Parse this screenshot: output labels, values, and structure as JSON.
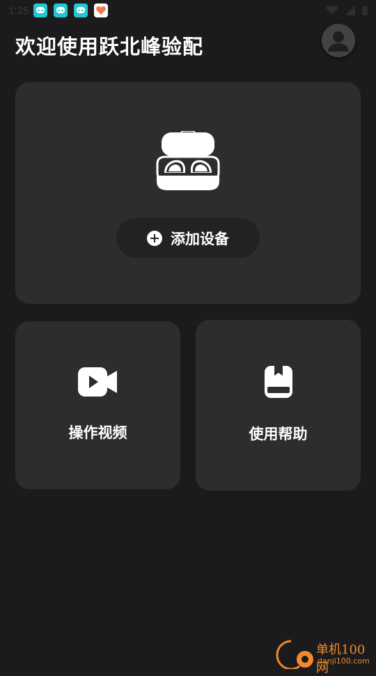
{
  "status_bar": {
    "time": "1:25",
    "notification_icons": [
      "app-icon-teal",
      "app-icon-teal",
      "app-icon-teal",
      "app-icon-orange"
    ],
    "right_icons": [
      "wifi-icon",
      "signal-icon",
      "battery-icon"
    ]
  },
  "header": {
    "title": "欢迎使用跃北峰验配",
    "avatar_icon": "user-avatar-icon"
  },
  "main_card": {
    "device_icon": "earbuds-case-icon",
    "add_button_label": "添加设备"
  },
  "tiles": {
    "video": {
      "label": "操作视频",
      "icon": "video-camera-icon"
    },
    "help": {
      "label": "使用帮助",
      "icon": "help-book-icon"
    }
  },
  "watermark": {
    "line1": "单机100网",
    "line2": "danji100.com"
  },
  "colors": {
    "background": "#1b1b1d",
    "card": "#2d2d2f",
    "button": "#222224",
    "text": "#ffffff",
    "watermark": "#f08a2a"
  }
}
